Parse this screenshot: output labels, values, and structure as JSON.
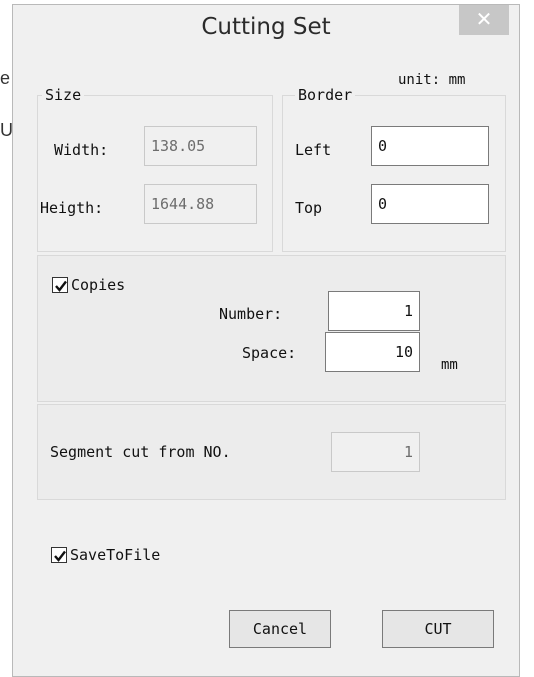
{
  "background": {
    "fragment_1": "e",
    "fragment_2": "U"
  },
  "dialog": {
    "title": "Cutting Set",
    "close_symbol": "✕"
  },
  "unit_label": "unit: mm",
  "size": {
    "legend": "Size",
    "width_label": "Width:",
    "width_value": "138.05",
    "height_label": "Heigth:",
    "height_value": "1644.88"
  },
  "border": {
    "legend": "Border",
    "left_label": "Left",
    "left_value": "0",
    "top_label": "Top",
    "top_value": "0"
  },
  "copies": {
    "label": "Copies",
    "checked": true,
    "number_label": "Number:",
    "number_value": "1",
    "space_label": "Space:",
    "space_value": "10",
    "space_unit": "mm"
  },
  "segment": {
    "label": "Segment cut from NO.",
    "value": "1"
  },
  "save_to_file": {
    "label": "SaveToFile",
    "checked": true
  },
  "buttons": {
    "cancel": "Cancel",
    "cut": "CUT"
  },
  "colors": {
    "dialog_bg": "#f0f0f0",
    "close_bg": "#c7c7c7",
    "border": "#d9d9d9"
  }
}
